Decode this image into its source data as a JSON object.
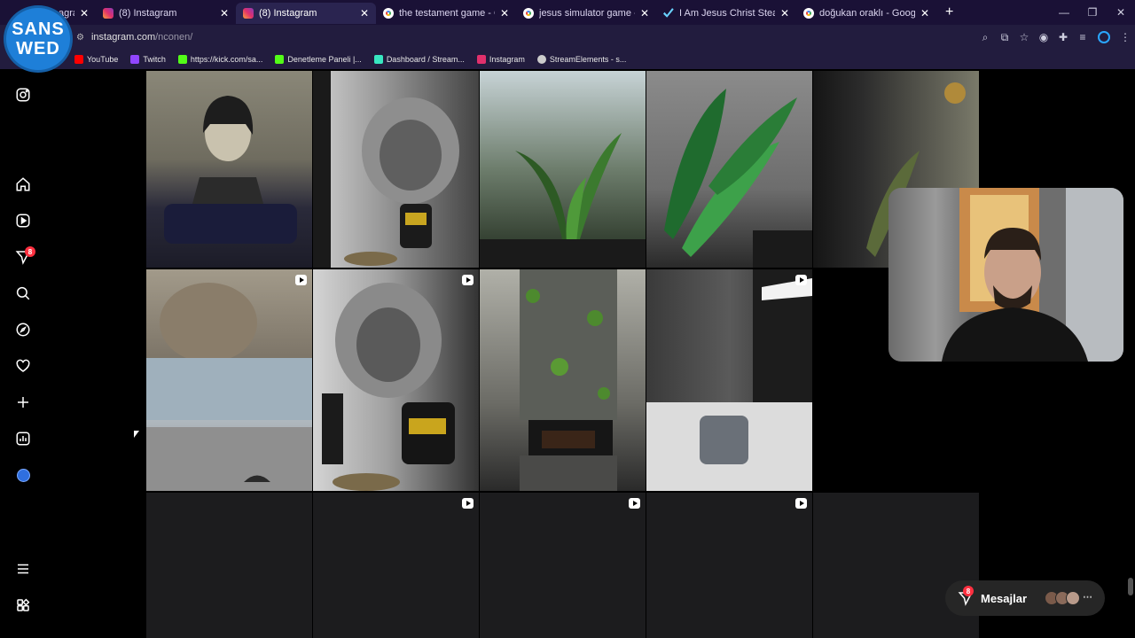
{
  "browser": {
    "tabs": [
      {
        "label": "agram",
        "favicon": "instagram-icon",
        "active": false
      },
      {
        "label": "(8) Instagram",
        "favicon": "instagram-icon",
        "active": false
      },
      {
        "label": "(8) Instagram",
        "favicon": "instagram-icon",
        "active": true
      },
      {
        "label": "the testament game - Google",
        "favicon": "google-icon",
        "active": false
      },
      {
        "label": "jesus simulator game - Google",
        "favicon": "google-icon",
        "active": false
      },
      {
        "label": "I Am Jesus Christ Steam'de",
        "favicon": "steam-icon",
        "active": false
      },
      {
        "label": "doğukan oraklı - Google'da Ara",
        "favicon": "google-icon",
        "active": false
      }
    ],
    "url_host": "instagram.com",
    "url_path": "/nconen/",
    "bookmarks": [
      {
        "label": "YouTube",
        "color": "#ff0000"
      },
      {
        "label": "Twitch",
        "color": "#9146ff"
      },
      {
        "label": "https://kick.com/sa...",
        "color": "#53fc18"
      },
      {
        "label": "Denetleme Paneli |...",
        "color": "#53fc18"
      },
      {
        "label": "Dashboard / Stream...",
        "color": "#38e6c0"
      },
      {
        "label": "Instagram",
        "color": "#e1306c"
      },
      {
        "label": "StreamElements - s...",
        "color": "#cccccc"
      }
    ]
  },
  "overlay_logo": {
    "line1": "SANS",
    "line2": "WED"
  },
  "sidebar": {
    "notifications_badge": "8"
  },
  "messages": {
    "label": "Mesajlar",
    "badge": "8"
  },
  "grid_posts": [
    {
      "row": 0,
      "col": 0,
      "subject": "portrait woman mural above dark sofa",
      "reel": false
    },
    {
      "row": 0,
      "col": 1,
      "subject": "classical statue mural hallway with chair",
      "reel": false
    },
    {
      "row": 0,
      "col": 2,
      "subject": "indoor plants under glass staircase",
      "reel": false
    },
    {
      "row": 0,
      "col": 3,
      "subject": "green leaf mural on concrete wall",
      "reel": false
    },
    {
      "row": 0,
      "col": 4,
      "subject": "leaf mural with chandelier",
      "reel": false
    },
    {
      "row": 1,
      "col": 0,
      "subject": "statue mural bathroom with glass",
      "reel": true
    },
    {
      "row": 1,
      "col": 1,
      "subject": "statue mural hallway with yellow chair",
      "reel": true
    },
    {
      "row": 1,
      "col": 2,
      "subject": "stone fireplace with moss",
      "reel": false
    },
    {
      "row": 1,
      "col": 3,
      "subject": "dark concrete hallway with ottoman",
      "reel": true
    },
    {
      "row": 2,
      "col": 0,
      "subject": "",
      "reel": false
    },
    {
      "row": 2,
      "col": 1,
      "subject": "",
      "reel": true
    },
    {
      "row": 2,
      "col": 2,
      "subject": "",
      "reel": true
    },
    {
      "row": 2,
      "col": 3,
      "subject": "",
      "reel": true
    },
    {
      "row": 2,
      "col": 4,
      "subject": "",
      "reel": false
    }
  ]
}
